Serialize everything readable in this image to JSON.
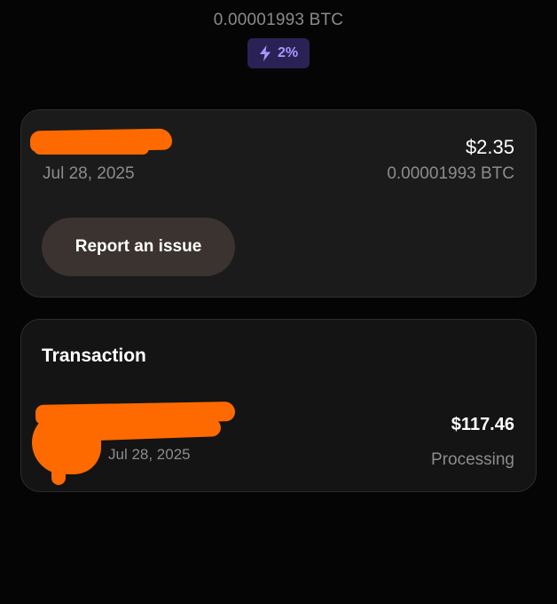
{
  "header": {
    "btc_amount": "0.00001993 BTC",
    "cashback_badge": {
      "icon": "lightning-bolt-icon",
      "label": "2%"
    }
  },
  "reward_card": {
    "date": "Jul 28, 2025",
    "amount_usd": "$2.35",
    "amount_btc": "0.00001993 BTC",
    "report_button_label": "Report an issue"
  },
  "transaction_card": {
    "heading": "Transaction",
    "item": {
      "date": "Jul 28, 2025",
      "amount": "$117.46",
      "status": "Processing"
    }
  },
  "colors": {
    "background": "#050505",
    "card": "#1b1b1b",
    "badge_bg": "#2a2254",
    "badge_fg": "#a996ff",
    "redaction": "#ff6a00",
    "muted_text": "#8c8c8c"
  }
}
